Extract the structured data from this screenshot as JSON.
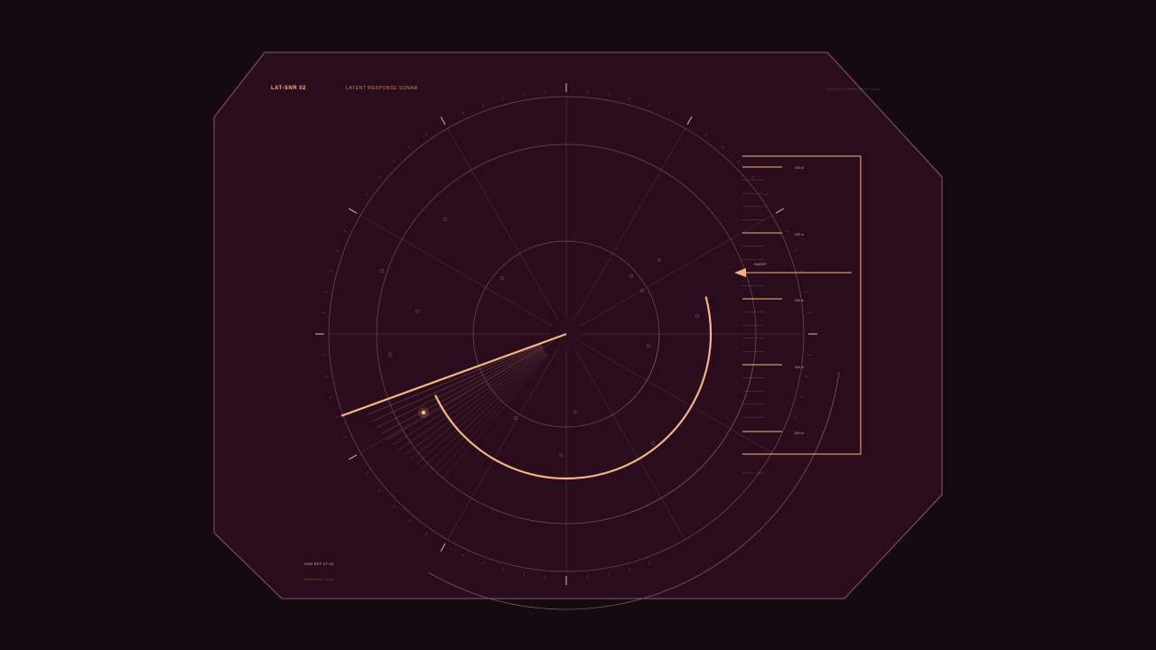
{
  "colors": {
    "background": "#140a10",
    "panel_fill": "#2a0d1c",
    "panel_stroke": "#8a5770",
    "accent": "#f3b584",
    "grid": "#7e5567",
    "text_dim": "#b9866f"
  },
  "header": {
    "title": "LAT-SNR 02",
    "subtitle": "LATENT RESPONSE SONAR",
    "corner_note": "ACOUSTIC RESPONSE FIELD"
  },
  "footer": {
    "code": "SNR REF 07-02",
    "caption": "Polar Return Scope"
  },
  "sonar": {
    "bearing_deg": 200,
    "contact_primary": "contact-highlight",
    "blips": 14
  },
  "range_scale": {
    "arrow_label": "SWEEP",
    "labels": [
      "100 m",
      "200 m",
      "300 m",
      "400 m",
      "500 m"
    ],
    "footer_note": "RANGE SCALE"
  },
  "icons": {
    "arrow": "left-arrow-icon",
    "target": "target-dot-icon"
  }
}
